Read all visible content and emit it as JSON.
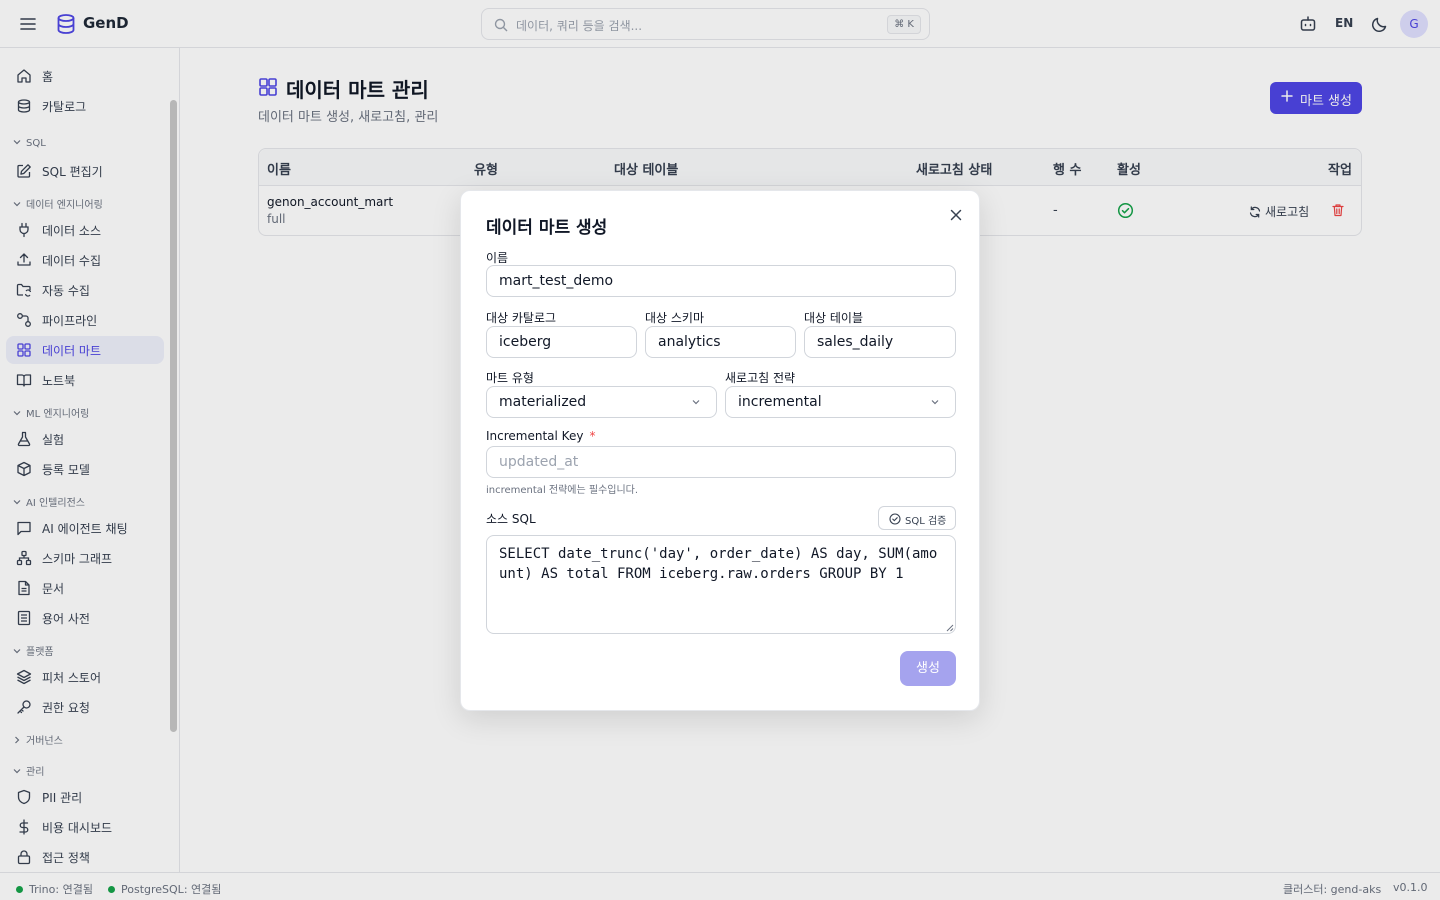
{
  "app": {
    "brand": "GenD",
    "search_placeholder": "데이터, 쿼리 등을 검색...",
    "search_shortcut": "⌘ K",
    "lang": "EN",
    "avatar_initial": "G",
    "accent_color": "#4f46e5"
  },
  "sidebar": {
    "items": [
      {
        "label": "홈",
        "icon": "home-icon"
      },
      {
        "label": "카탈로그",
        "icon": "database-icon"
      },
      {
        "label": "SQL 편집기",
        "icon": "edit-icon"
      },
      {
        "label": "데이터 소스",
        "icon": "plug-icon"
      },
      {
        "label": "데이터 수집",
        "icon": "upload-icon"
      },
      {
        "label": "자동 수집",
        "icon": "folder-sync-icon"
      },
      {
        "label": "파이프라인",
        "icon": "pipeline-icon"
      },
      {
        "label": "데이터 마트",
        "icon": "grid-icon"
      },
      {
        "label": "노트북",
        "icon": "book-icon"
      },
      {
        "label": "실험",
        "icon": "flask-icon"
      },
      {
        "label": "등록 모델",
        "icon": "box-icon"
      },
      {
        "label": "AI 에이전트 채팅",
        "icon": "chat-icon"
      },
      {
        "label": "스키마 그래프",
        "icon": "graph-icon"
      },
      {
        "label": "문서",
        "icon": "document-icon"
      },
      {
        "label": "용어 사전",
        "icon": "glossary-icon"
      },
      {
        "label": "피처 스토어",
        "icon": "layers-icon"
      },
      {
        "label": "권한 요청",
        "icon": "key-icon"
      },
      {
        "label": "PII 관리",
        "icon": "shield-icon"
      },
      {
        "label": "비용 대시보드",
        "icon": "dollar-icon"
      },
      {
        "label": "접근 정책",
        "icon": "lock-icon"
      }
    ],
    "sections": [
      "SQL",
      "데이터 엔지니어링",
      "ML 엔지니어링",
      "AI 인텔리전스",
      "플랫폼",
      "거버넌스",
      "관리"
    ]
  },
  "page": {
    "title": "데이터 마트 관리",
    "subtitle": "데이터 마트 생성, 새로고침, 관리",
    "create_button": "마트 생성"
  },
  "table": {
    "headers": [
      "이름",
      "유형",
      "대상 테이블",
      "새로고침 상태",
      "행 수",
      "활성",
      "작업"
    ],
    "rows": [
      {
        "name": "genon_account_mart",
        "type": "full",
        "rows": "-",
        "refresh_label": "새로고침"
      }
    ]
  },
  "footer": {
    "trino": "Trino: 연결됨",
    "postgres": "PostgreSQL: 연결됨",
    "cluster": "클러스터: gend-aks",
    "version": "v0.1.0"
  },
  "modal": {
    "title": "데이터 마트 생성",
    "name_label": "이름",
    "name_value": "mart_test_demo",
    "catalog_label": "대상 카탈로그",
    "catalog_value": "iceberg",
    "schema_label": "대상 스키마",
    "schema_value": "analytics",
    "table_label": "대상 테이블",
    "table_value": "sales_daily",
    "mart_type_label": "마트 유형",
    "mart_type_value": "materialized",
    "refresh_label": "새로고침 전략",
    "refresh_value": "incremental",
    "inc_key_label": "Incremental Key",
    "inc_key_required": "*",
    "inc_key_placeholder": "updated_at",
    "inc_key_hint": "incremental 전략에는 필수입니다.",
    "sql_label": "소스 SQL",
    "sql_check_label": "SQL 검증",
    "sql_value": "SELECT date_trunc('day', order_date) AS day, SUM(amount) AS total FROM iceberg.raw.orders GROUP BY 1",
    "submit_label": "생성"
  }
}
